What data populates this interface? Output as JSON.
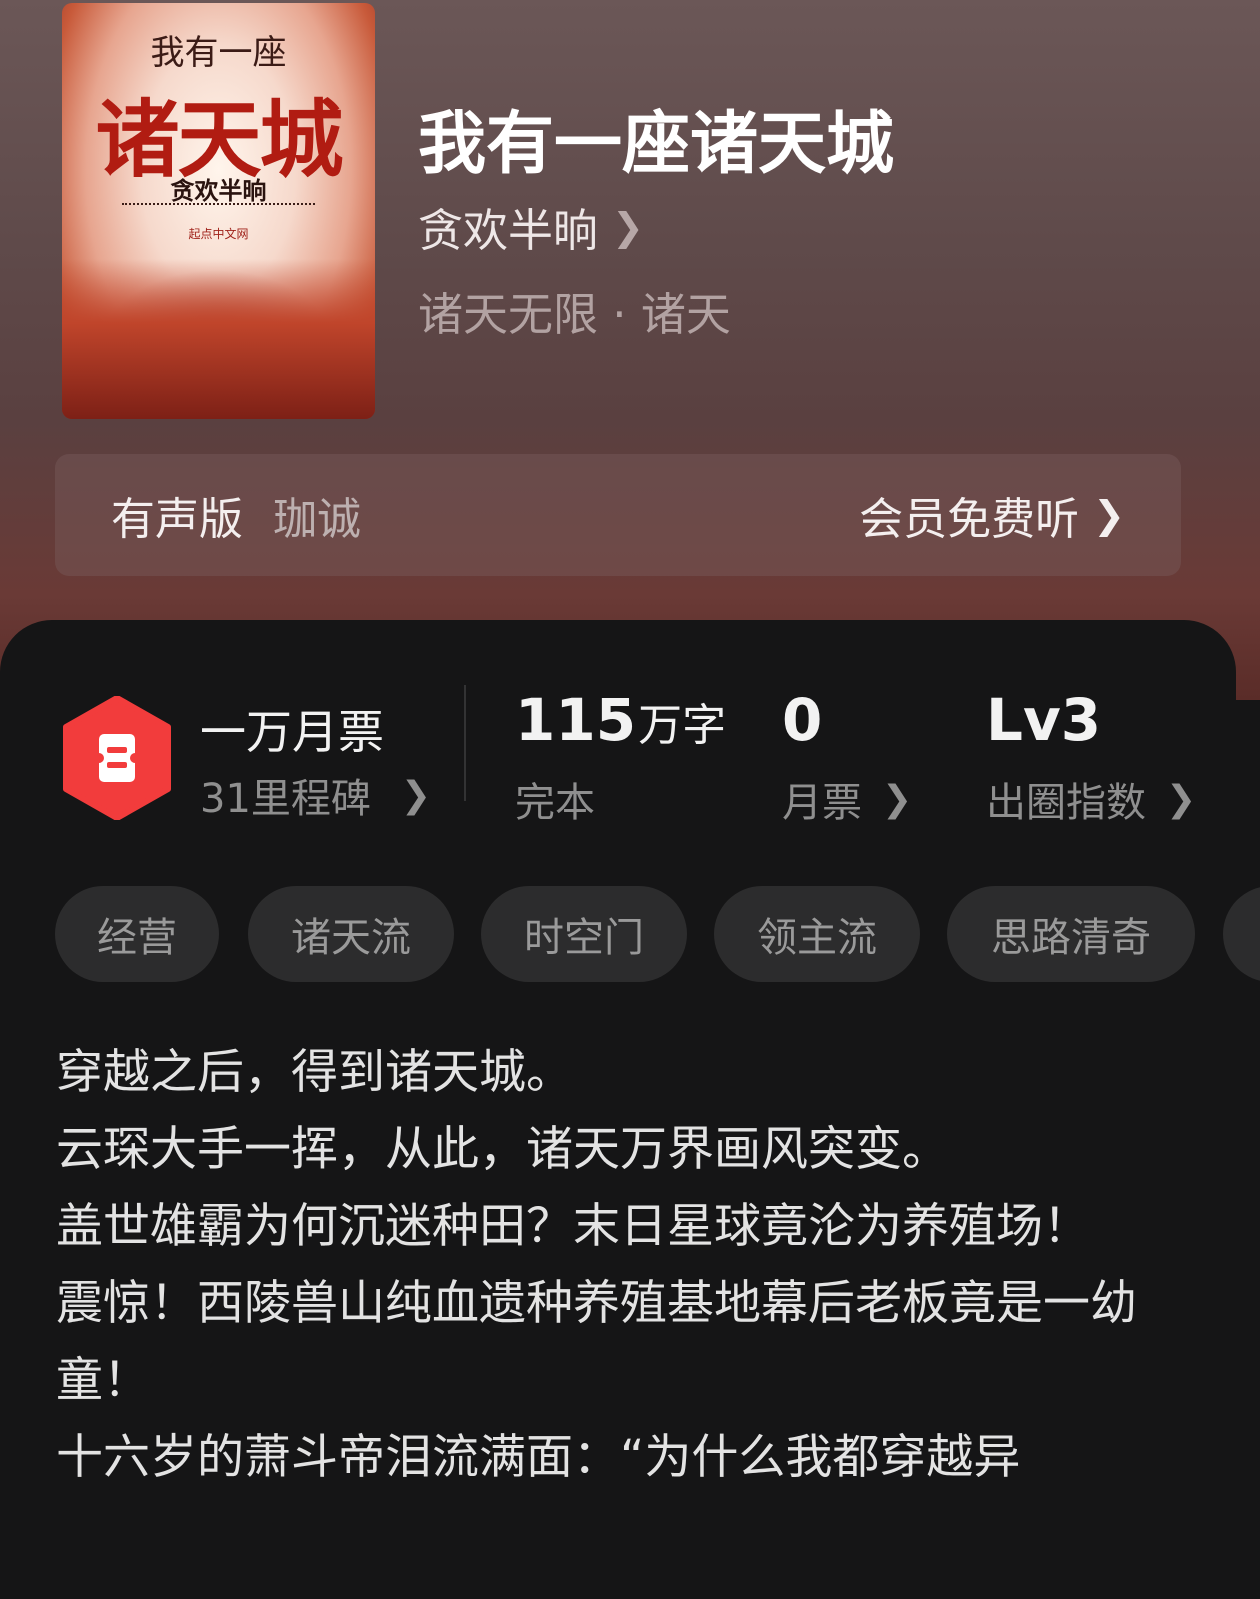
{
  "book": {
    "title": "我有一座诸天城",
    "author": "贪欢半晌",
    "genre": "诸天无限 · 诸天",
    "cover": {
      "top_line": "我有一座",
      "main_title": "诸天城",
      "author": "贪欢半晌",
      "publisher": "起点中文网"
    }
  },
  "audio": {
    "label": "有声版",
    "narrator": "珈诚",
    "action": "会员免费听"
  },
  "stats": {
    "monthly_ticket_badge": "一万月票",
    "milestones": "31里程碑",
    "word_count": "115",
    "word_unit": "万字",
    "status": "完本",
    "tickets": "0",
    "tickets_label": "月票",
    "level": "Lv3",
    "level_label": "出圈指数"
  },
  "tags": [
    "经营",
    "诸天流",
    "时空门",
    "领主流",
    "思路清奇"
  ],
  "description": [
    "穿越之后，得到诸天城。",
    "云琛大手一挥，从此，诸天万界画风突变。",
    "盖世雄霸为何沉迷种田？末日星球竟沦为养殖场！",
    "震惊！西陵兽山纯血遗种养殖基地幕后老板竟是一幼童！",
    "十六岁的萧斗帝泪流满面：“为什么我都穿越异"
  ],
  "colors": {
    "accent_red": "#f23c3c",
    "panel_bg": "#151516",
    "tag_bg": "#2c2c2d"
  },
  "icons": {
    "chevron": "chevron-right-icon",
    "badge": "ticket-badge-icon"
  }
}
